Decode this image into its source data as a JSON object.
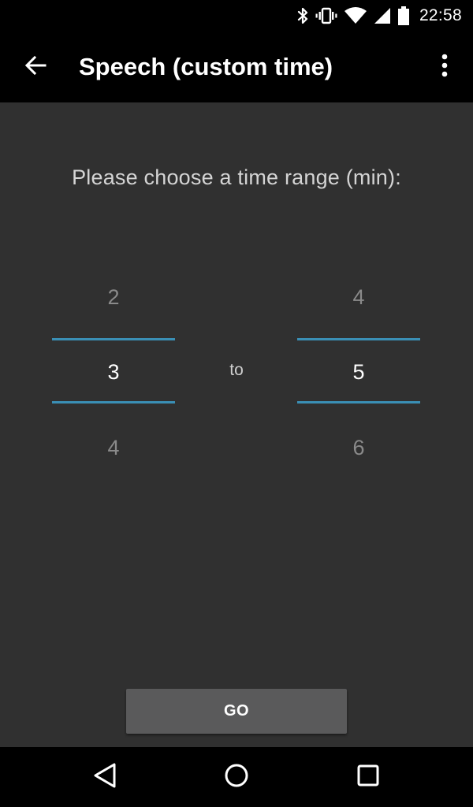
{
  "status_bar": {
    "time": "22:58",
    "icons": [
      "bluetooth-icon",
      "vibrate-icon",
      "wifi-icon",
      "cell-signal-icon",
      "battery-icon"
    ]
  },
  "app_bar": {
    "title": "Speech (custom time)",
    "back_icon": "arrow-left-icon",
    "menu_icon": "more-vert-icon"
  },
  "main": {
    "prompt": "Please choose a time range (min):",
    "from_picker": {
      "prev": "2",
      "current": "3",
      "next": "4"
    },
    "separator": "to",
    "to_picker": {
      "prev": "4",
      "current": "5",
      "next": "6"
    },
    "go_label": "GO"
  },
  "nav_bar": {
    "icons": [
      "nav-back-icon",
      "nav-home-icon",
      "nav-recents-icon"
    ]
  },
  "colors": {
    "background": "#303030",
    "bars": "#000000",
    "accent": "#3a8fb5",
    "button": "#5a5a5b"
  }
}
